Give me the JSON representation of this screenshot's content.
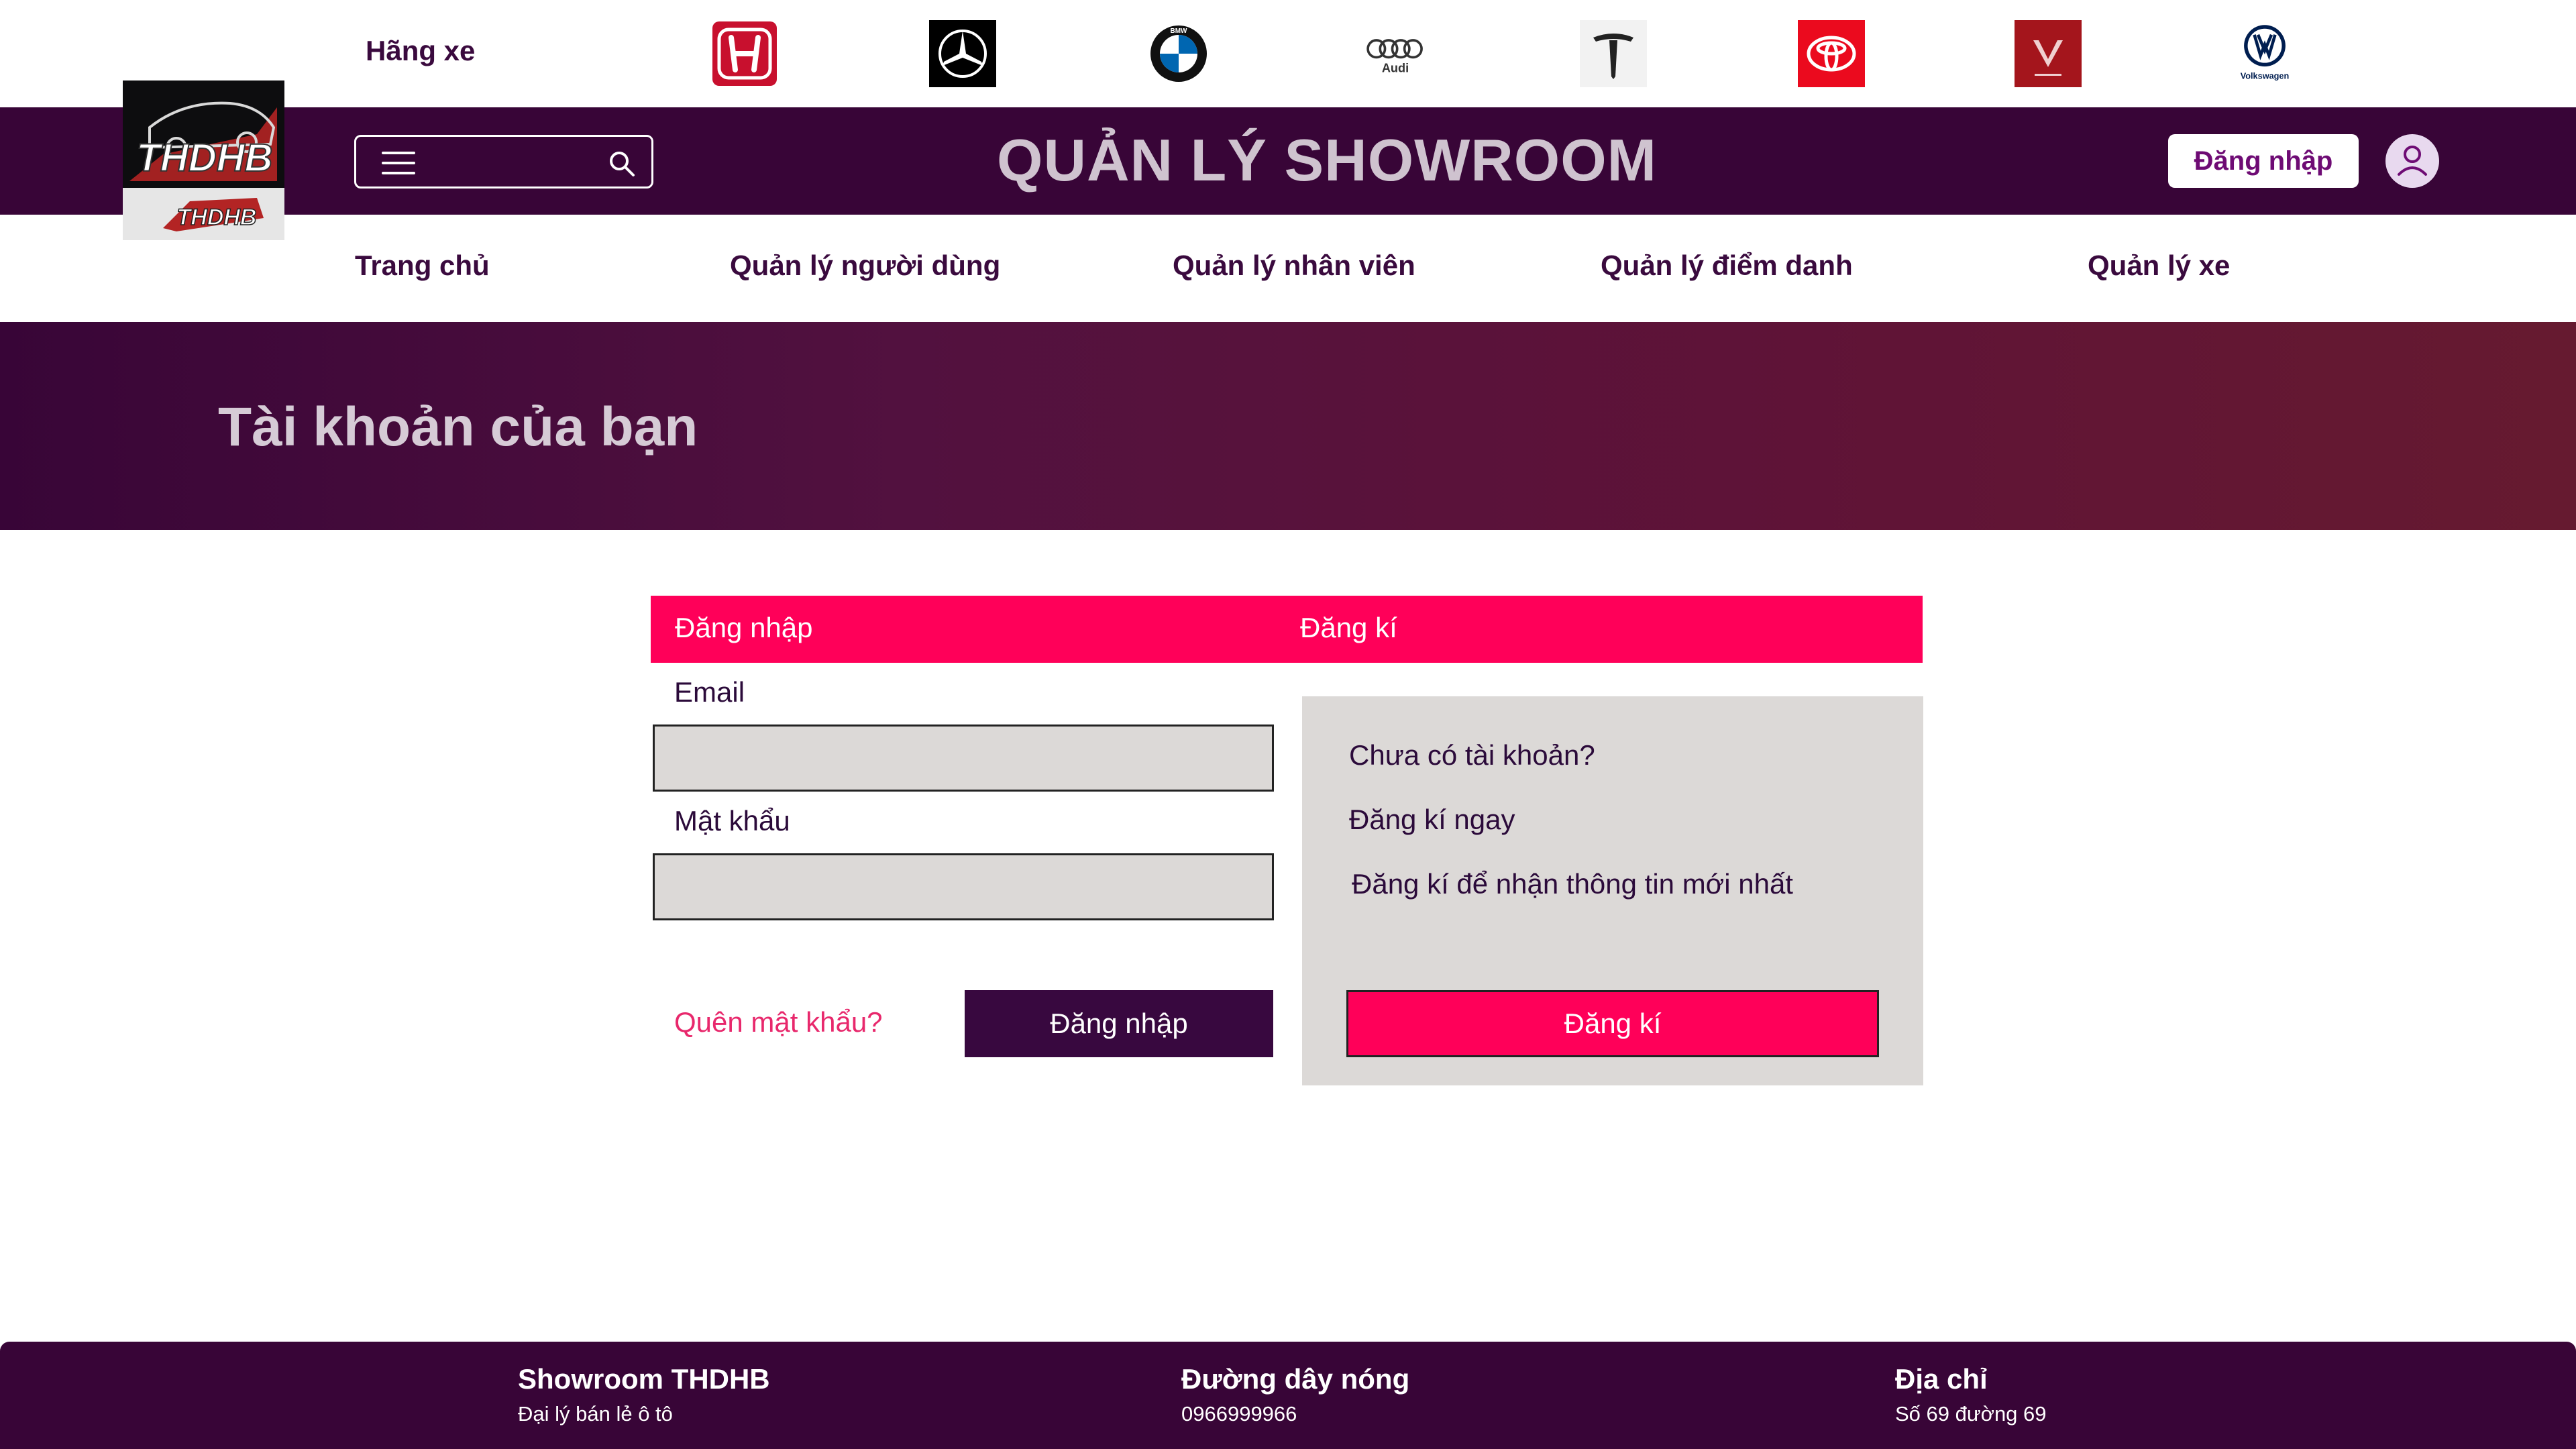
{
  "brands": {
    "label": "Hãng xe",
    "logos": [
      {
        "name": "Honda",
        "color": "#c8102e"
      },
      {
        "name": "Mercedes-Benz",
        "color": "#000000"
      },
      {
        "name": "BMW",
        "color": "#0066b1"
      },
      {
        "name": "Audi",
        "text": "Audi",
        "color": "#333333"
      },
      {
        "name": "Tesla",
        "color": "#222222"
      },
      {
        "name": "Toyota",
        "color": "#eb0a1e"
      },
      {
        "name": "VinFast",
        "color": "#a4151c"
      },
      {
        "name": "Volkswagen",
        "text": "Volkswagen",
        "color": "#001e50"
      }
    ]
  },
  "header": {
    "title": "QUẢN LÝ SHOWROOM",
    "login_label": "Đăng nhập",
    "logo_text": "THDHB"
  },
  "nav": {
    "items": [
      {
        "label": "Trang chủ"
      },
      {
        "label": "Quản lý người dùng"
      },
      {
        "label": "Quản lý nhân viên"
      },
      {
        "label": "Quản lý điểm danh"
      },
      {
        "label": "Quản lý xe"
      }
    ]
  },
  "banner": {
    "title": "Tài khoản của bạn"
  },
  "account": {
    "tabs": {
      "login": "Đăng nhập",
      "register": "Đăng kí"
    },
    "email_label": "Email",
    "email_value": "",
    "password_label": "Mật khẩu",
    "password_value": "",
    "forgot_label": "Quên mật khẩu?",
    "login_button": "Đăng nhập",
    "register_panel": {
      "line1": "Chưa có tài khoản?",
      "line2": "Đăng kí ngay",
      "line3": "Đăng kí để nhận thông tin mới nhất",
      "button": "Đăng kí"
    }
  },
  "footer": {
    "showroom": {
      "title": "Showroom THDHB",
      "subtitle": "Đại lý bán lẻ ô tô"
    },
    "hotline": {
      "title": "Đường dây nóng",
      "subtitle": "0966999966"
    },
    "address": {
      "title": "Địa chỉ",
      "subtitle": "Số 69 đường 69"
    }
  },
  "colors": {
    "primary": "#380537",
    "accent": "#ff0059",
    "panel": "#dcd9d7"
  }
}
